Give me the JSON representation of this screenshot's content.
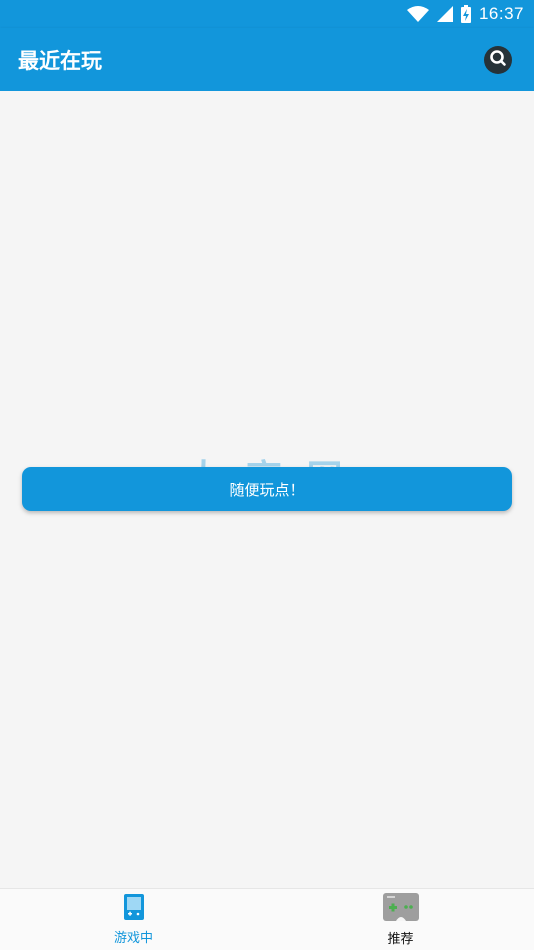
{
  "status_bar": {
    "time": "16:37",
    "icons": [
      "wifi-icon",
      "signal-icon",
      "battery-charging-icon"
    ]
  },
  "app_bar": {
    "title": "最近在玩",
    "action_icon": "search-icon"
  },
  "main": {
    "watermark": "大 高 网",
    "random_button_label": "随便玩点！"
  },
  "bottom_nav": {
    "items": [
      {
        "label": "游戏中",
        "icon": "gameboy-icon",
        "active": true
      },
      {
        "label": "推荐",
        "icon": "gamepad-icon",
        "active": false
      }
    ]
  },
  "colors": {
    "primary": "#1296db",
    "background": "#f5f5f5",
    "search_button": "#263238"
  }
}
